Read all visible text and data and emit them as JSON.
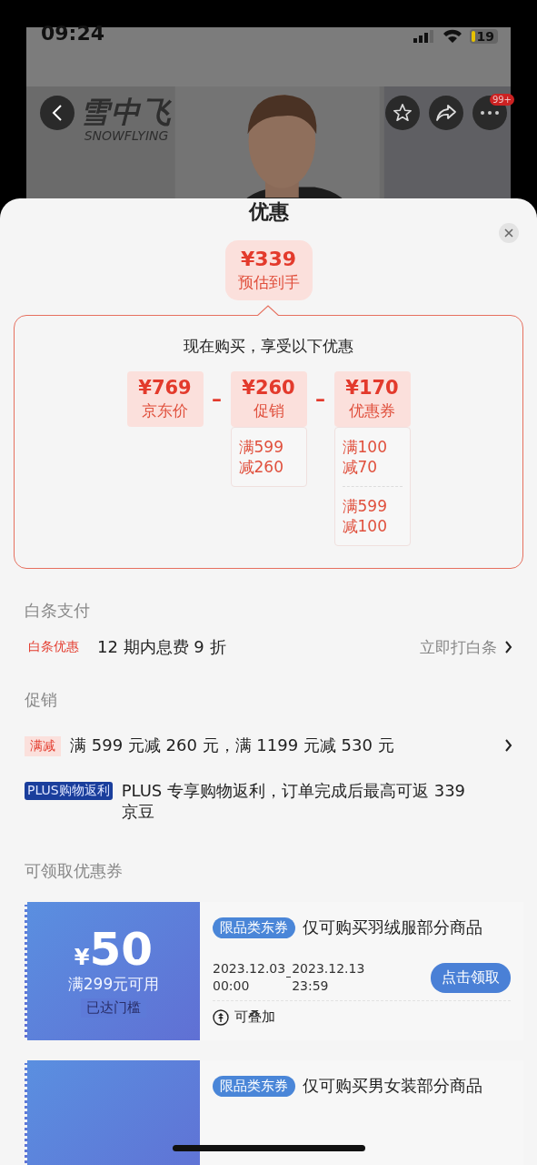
{
  "status_bar": {
    "time": "09:24",
    "battery": "19"
  },
  "header": {
    "brand": "雪中飞",
    "brand_latin": "SNOWFLYING",
    "badge": "99+"
  },
  "sheet": {
    "title": "优惠"
  },
  "estimate": {
    "price": "¥339",
    "label": "预估到手"
  },
  "breakdown": {
    "heading": "现在购买，享受以下优惠",
    "items": [
      {
        "price": "¥769",
        "label": "京东价"
      },
      {
        "operator": "–",
        "price": "¥260",
        "label": "促销",
        "details": [
          {
            "lines": [
              "满599",
              "减260"
            ]
          }
        ]
      },
      {
        "operator": "–",
        "price": "¥170",
        "label": "优惠券",
        "details": [
          {
            "lines": [
              "满100",
              "减70"
            ]
          },
          {
            "lines": [
              "满599",
              "减100"
            ]
          }
        ]
      }
    ]
  },
  "baitiao": {
    "heading": "白条支付",
    "tag": "白条优惠",
    "text": "12 期内息费 9 折",
    "action": "立即打白条"
  },
  "promotions": {
    "heading": "促销",
    "items": [
      {
        "kind": "tag",
        "tag": "满减",
        "text": "满 599 元减 260 元，满 1199 元减 530 元",
        "has_arrow": true
      },
      {
        "kind": "plus",
        "tag": "PLUS购物返利",
        "text": "PLUS 专享购物返利，订单完成后最高可返 339 京豆",
        "has_arrow": false
      }
    ]
  },
  "coupons": {
    "heading": "可领取优惠券",
    "items": [
      {
        "currency": "¥",
        "amount": "50",
        "condition": "满299元可用",
        "status": "已达门槛",
        "tag": "限品类东券",
        "title": "仅可购买羽绒服部分商品",
        "start_date": "2023.12.03",
        "start_time": "00:00",
        "end_date": "2023.12.13",
        "end_time": "23:59",
        "stackable": "可叠加",
        "button": "点击领取"
      },
      {
        "tag": "限品类东券",
        "title": "仅可购买男女装部分商品"
      }
    ]
  }
}
